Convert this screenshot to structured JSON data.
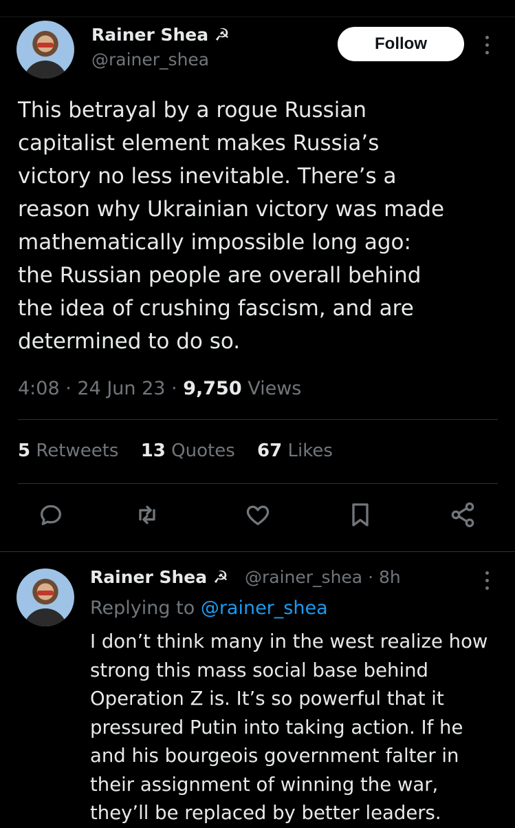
{
  "main_tweet": {
    "author_name": "Rainer Shea ☭",
    "author_handle": "@rainer_shea",
    "follow_label": "Follow",
    "text": "This betrayal by a rogue Russian\ncapitalist element makes Russia’s\nvictory no less inevitable. There’s a\nreason why Ukrainian victory was made\nmathematically impossible long ago:\nthe Russian people are overall behind\nthe idea of crushing fascism, and are\ndetermined to do so.",
    "time": "4:08",
    "date": "24 Jun 23",
    "views_count": "9,750",
    "views_label": "Views",
    "retweets_count": "5",
    "retweets_label": "Retweets",
    "quotes_count": "13",
    "quotes_label": "Quotes",
    "likes_count": "67",
    "likes_label": "Likes"
  },
  "actions": [
    {
      "name": "reply-icon"
    },
    {
      "name": "retweet-icon"
    },
    {
      "name": "like-icon"
    },
    {
      "name": "bookmark-icon"
    },
    {
      "name": "share-icon"
    }
  ],
  "reply_tweet": {
    "author_name": "Rainer Shea ☭",
    "author_handle": "@rainer_shea · 8h",
    "replying_prefix": "Replying to",
    "replying_to": "@rainer_shea",
    "text": "I don’t think many in the west realize how\nstrong this mass social base behind\nOperation Z is. It’s so powerful that it\npressured Putin into taking action. If he\nand his bourgeois government falter in\ntheir assignment of winning the war,\nthey’ll be replaced by better leaders."
  },
  "colors": {
    "background": "#000000",
    "text": "#e7e9ea",
    "muted": "#71767b",
    "link": "#1d9bf0"
  }
}
